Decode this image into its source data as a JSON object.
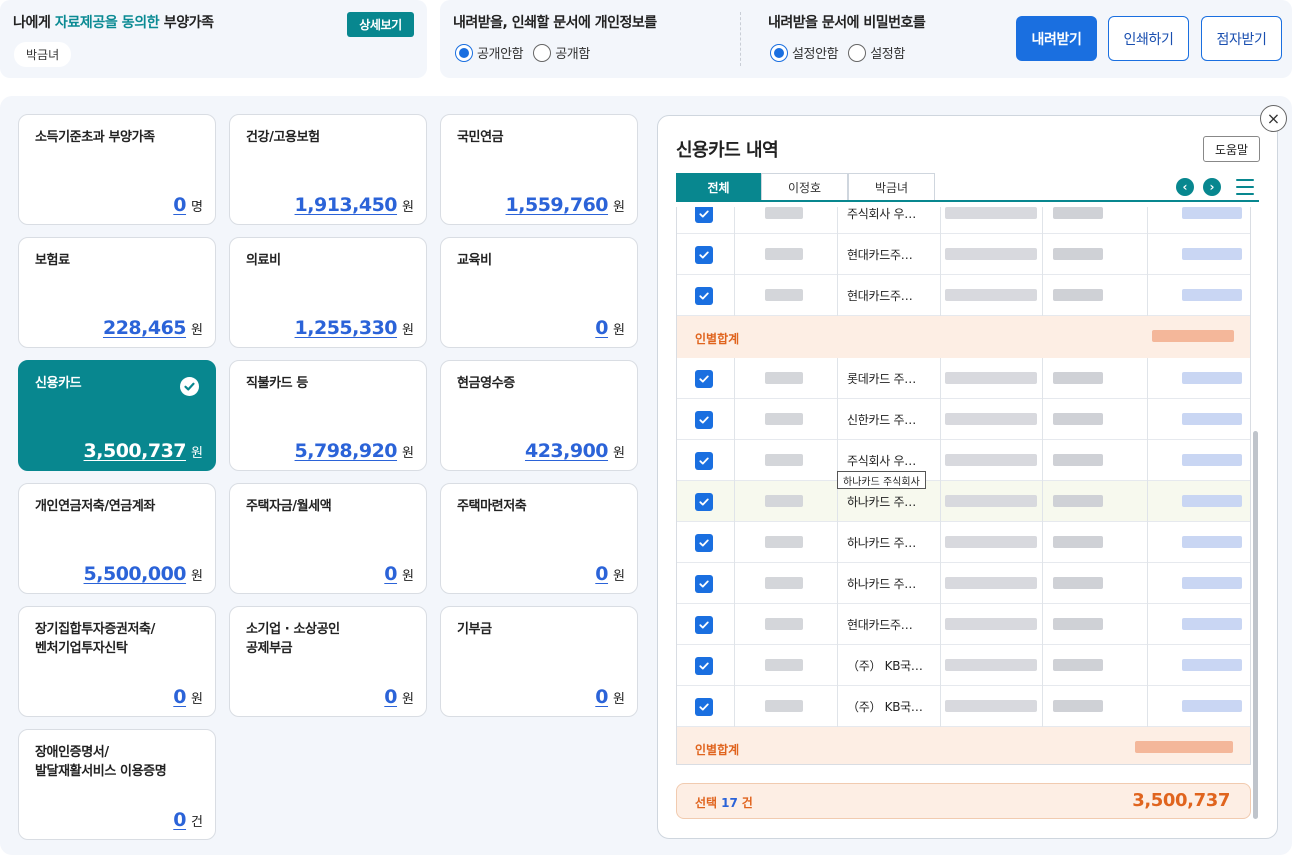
{
  "consent": {
    "title_prefix": "나에게 ",
    "title_highlight": "자료제공을 동의한",
    "title_suffix": " 부양가족",
    "detail_button": "상세보기",
    "person": "박금녀"
  },
  "options": {
    "privacy": {
      "title": "내려받을, 인쇄할 문서에 개인정보를",
      "opt1": "공개안함",
      "opt2": "공개함",
      "selected": "공개안함"
    },
    "password": {
      "title": "내려받을 문서에 비밀번호를",
      "opt1": "설정안함",
      "opt2": "설정함",
      "selected": "설정안함"
    }
  },
  "buttons": {
    "download": "내려받기",
    "print": "인쇄하기",
    "braille": "점자받기"
  },
  "cards": [
    {
      "title": "소득기준초과 부양가족",
      "value": "0",
      "unit": "명"
    },
    {
      "title": "건강/고용보험",
      "value": "1,913,450",
      "unit": "원"
    },
    {
      "title": "국민연금",
      "value": "1,559,760",
      "unit": "원"
    },
    {
      "title": "보험료",
      "value": "228,465",
      "unit": "원"
    },
    {
      "title": "의료비",
      "value": "1,255,330",
      "unit": "원"
    },
    {
      "title": "교육비",
      "value": "0",
      "unit": "원"
    },
    {
      "title": "신용카드",
      "value": "3,500,737",
      "unit": "원",
      "active": true
    },
    {
      "title": "직불카드 등",
      "value": "5,798,920",
      "unit": "원"
    },
    {
      "title": "현금영수증",
      "value": "423,900",
      "unit": "원"
    },
    {
      "title": "개인연금저축/연금계좌",
      "value": "5,500,000",
      "unit": "원"
    },
    {
      "title": "주택자금/월세액",
      "value": "0",
      "unit": "원"
    },
    {
      "title": "주택마련저축",
      "value": "0",
      "unit": "원"
    },
    {
      "title": "장기집합투자증권저축/\n벤처기업투자신탁",
      "value": "0",
      "unit": "원"
    },
    {
      "title": "소기업 · 소상공인\n공제부금",
      "value": "0",
      "unit": "원"
    },
    {
      "title": "기부금",
      "value": "0",
      "unit": "원"
    },
    {
      "title": "장애인증명서/\n발달재활서비스 이용증명",
      "value": "0",
      "unit": "건"
    }
  ],
  "panel": {
    "title": "신용카드 내역",
    "help": "도움말",
    "close": "×",
    "tabs": [
      "전체",
      "이정호",
      "박금녀"
    ],
    "rows_a": [
      "주식회사 우…",
      "현대카드주…",
      "현대카드주…"
    ],
    "subtotal_label": "인별합계",
    "rows_b": [
      "롯데카드 주…",
      "신한카드 주…",
      "주식회사 우…",
      "하나카드 주…",
      "하나카드 주…",
      "하나카드 주…",
      "현대카드주…",
      "（주） KB국…",
      "（주） KB국…"
    ],
    "tooltip": "하나카드 주식회사",
    "summary_prefix": "선택",
    "summary_count": "17",
    "summary_unit": "건",
    "summary_total": "3,500,737"
  },
  "colors": {
    "teal": "#08878f",
    "blue": "#1a6fe0",
    "orange": "#e0641e"
  }
}
